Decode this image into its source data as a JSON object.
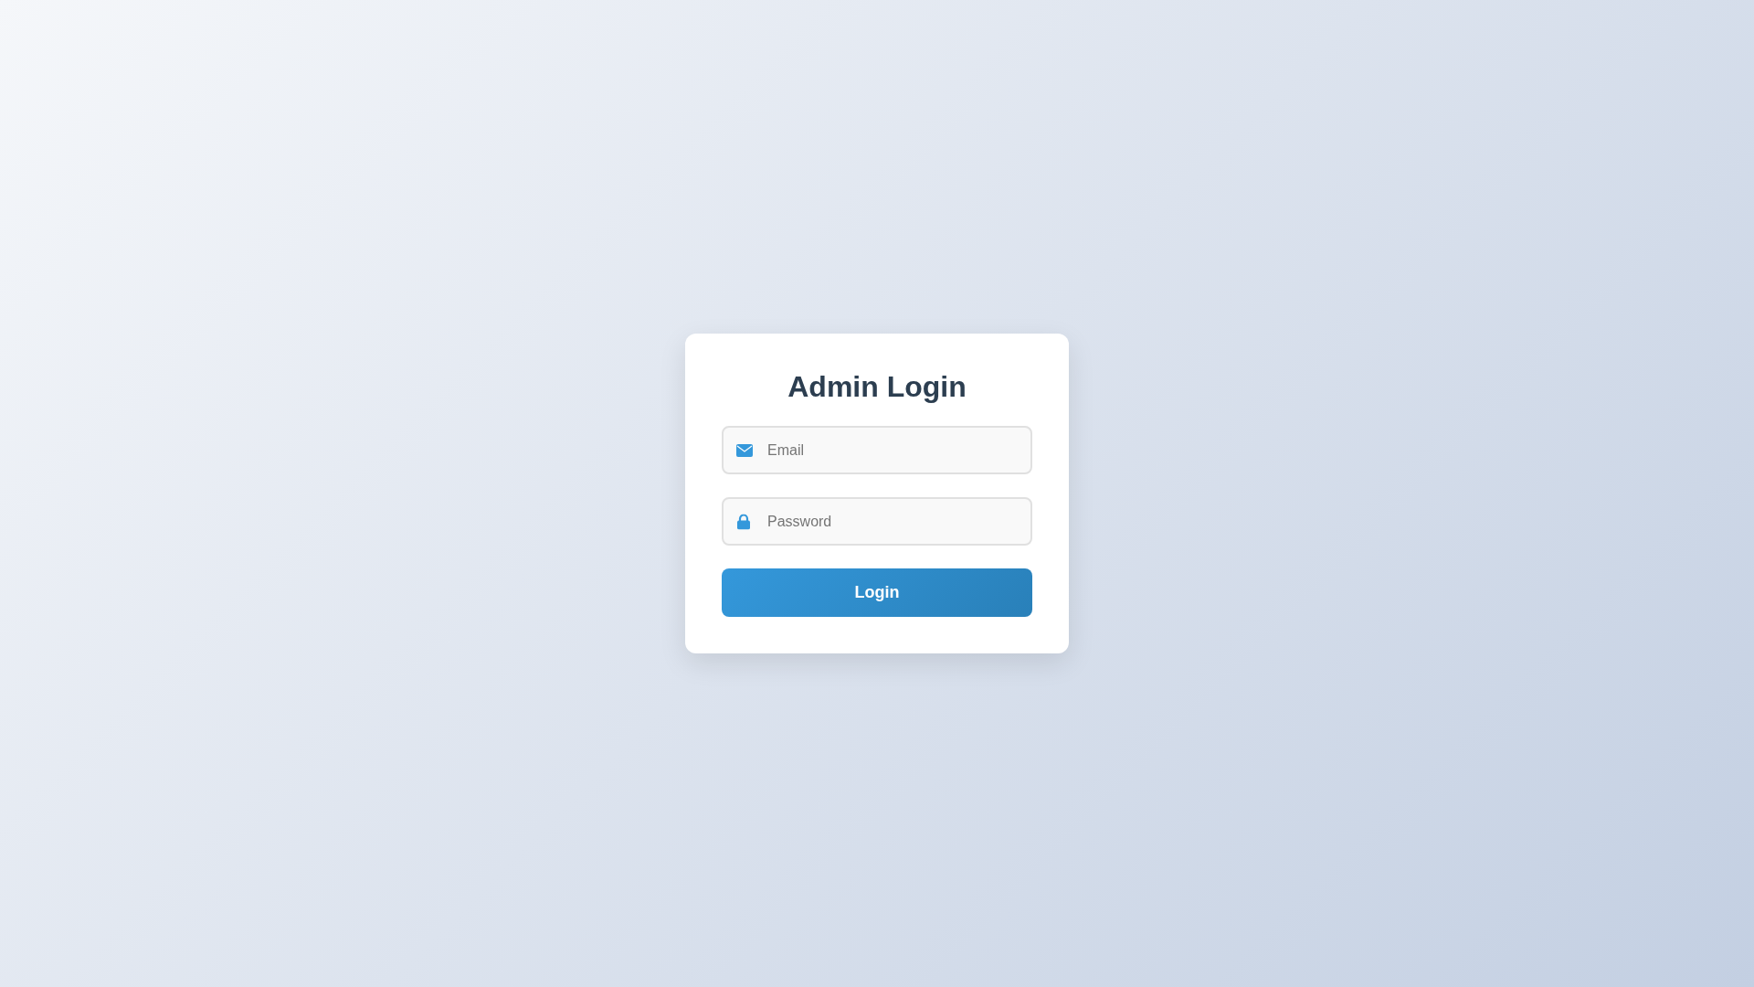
{
  "title": "Admin Login",
  "fields": [
    {
      "kind": "email",
      "placeholder": "Email"
    },
    {
      "kind": "password",
      "placeholder": "Password"
    }
  ],
  "button": {
    "label": "Login"
  }
}
